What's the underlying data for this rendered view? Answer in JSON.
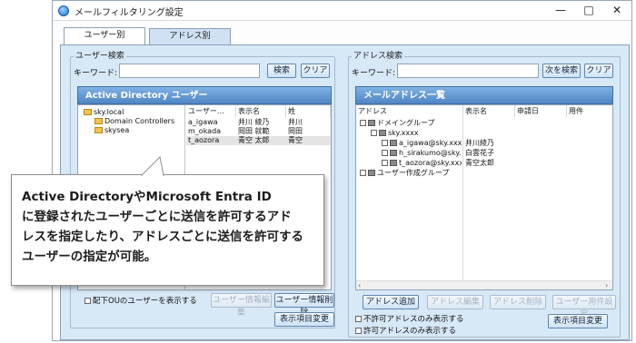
{
  "window": {
    "title": "メールフィルタリング設定",
    "min": "—",
    "max": "□",
    "close": "✕"
  },
  "tabs": [
    {
      "label": "ユーザー別"
    },
    {
      "label": "アドレス別"
    }
  ],
  "user_search": {
    "group_label": "ユーザー検索",
    "keyword_label": "キーワード:",
    "keyword_value": "",
    "search_button": "検索",
    "clear_button": "クリア"
  },
  "ad_panel": {
    "title": "Active Directory ユーザー",
    "tree": [
      "sky.local",
      "Domain Controllers",
      "skysea"
    ],
    "columns": [
      "ユーザー…",
      "表示名",
      "姓"
    ],
    "rows": [
      {
        "user": "a_igawa",
        "name": "井川 綾乃",
        "sei": "井川"
      },
      {
        "user": "m_okada",
        "name": "岡田 就範",
        "sei": "岡田"
      },
      {
        "user": "t_aozora",
        "name": "青空 太郎",
        "sei": "青空"
      }
    ],
    "sub_ou_label": "配下OUのユーザーを表示する",
    "edit_button": "ユーザー情報編集",
    "delete_button": "ユーザー情報削除",
    "display_items_button": "表示項目変更"
  },
  "address_search": {
    "group_label": "アドレス検索",
    "keyword_label": "キーワード:",
    "keyword_value": "",
    "next_button": "次を検索",
    "clear_button": "クリア"
  },
  "mail_panel": {
    "title": "メールアドレス一覧",
    "columns": [
      "アドレス",
      "表示名",
      "申請日",
      "用件"
    ],
    "tree": [
      {
        "label": "ドメイングループ",
        "name": ""
      },
      {
        "label": "sky.xxxx",
        "name": ""
      },
      {
        "label": "a_igawa@sky.xxxx",
        "name": "井川綾乃"
      },
      {
        "label": "h_sirakumo@sky.x…",
        "name": "白雲花子"
      },
      {
        "label": "t_aozora@sky.xxxx",
        "name": "青空太郎"
      },
      {
        "label": "ユーザー作成グループ",
        "name": ""
      }
    ],
    "add_button": "アドレス追加",
    "edit_button": "アドレス編集",
    "delete_button": "アドレス削除",
    "user_settings_button": "ユーザー用件設定",
    "show_denied_label": "不許可アドレスのみ表示する",
    "show_allowed_label": "許可アドレスのみ表示する",
    "display_items_button": "表示項目変更"
  },
  "callout": {
    "lines": [
      "Active DirectoryやMicrosoft Entra ID",
      "に登録されたユーザーごとに送信を許可するアド",
      "レスを指定したり、アドレスごとに送信を許可する",
      "ユーザーの指定が可能。"
    ]
  }
}
